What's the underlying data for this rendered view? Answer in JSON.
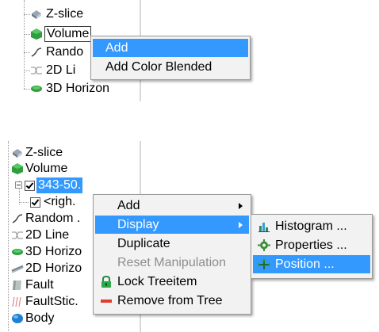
{
  "top_tree": {
    "items": [
      {
        "label": "Z-slice",
        "icon": "z-slice-icon"
      },
      {
        "label": "Volume",
        "icon": "volume-icon"
      },
      {
        "label": "Rando",
        "icon": "random-line-icon"
      },
      {
        "label": "2D Li",
        "icon": "2d-line-icon"
      },
      {
        "label": "3D Horizon",
        "icon": "3d-horizon-icon"
      }
    ]
  },
  "top_menu": {
    "items": [
      {
        "label": "Add",
        "highlighted": true
      },
      {
        "label": "Add Color Blended",
        "highlighted": false
      }
    ]
  },
  "bottom_tree": {
    "items": [
      {
        "label": "Z-slice",
        "icon": "z-slice-icon"
      },
      {
        "label": "Volume",
        "icon": "volume-icon"
      },
      {
        "label": "343-50.",
        "icon": "checkbox-icon"
      },
      {
        "label": "<righ.",
        "icon": "checkbox-icon"
      },
      {
        "label": "Random .",
        "icon": "random-line-icon"
      },
      {
        "label": "2D Line",
        "icon": "2d-line-icon"
      },
      {
        "label": "3D Horizo",
        "icon": "3d-horizon-icon"
      },
      {
        "label": "2D Horizo",
        "icon": "2d-horizon-icon"
      },
      {
        "label": "Fault",
        "icon": "fault-icon"
      },
      {
        "label": "FaultStic.",
        "icon": "faultstick-icon"
      },
      {
        "label": "Body",
        "icon": "body-icon"
      }
    ]
  },
  "context_menu": {
    "items": [
      {
        "label": "Add",
        "submenu": true,
        "enabled": true
      },
      {
        "label": "Display",
        "submenu": true,
        "highlighted": true,
        "enabled": true
      },
      {
        "label": "Duplicate",
        "enabled": true
      },
      {
        "label": "Reset Manipulation",
        "enabled": false
      },
      {
        "label": "Lock Treeitem",
        "icon": "lock-icon",
        "enabled": true
      },
      {
        "label": "Remove from Tree",
        "icon": "remove-icon",
        "enabled": true
      }
    ]
  },
  "display_submenu": {
    "items": [
      {
        "label": "Histogram ...",
        "icon": "histogram-icon"
      },
      {
        "label": "Properties ...",
        "icon": "gear-icon"
      },
      {
        "label": "Position ...",
        "icon": "position-icon",
        "highlighted": true
      }
    ]
  },
  "colors": {
    "highlight": "#3399ff",
    "menu_bg": "#f2f2f2",
    "volume_green": "#2e9e3e",
    "remove_red": "#e03c2c"
  }
}
